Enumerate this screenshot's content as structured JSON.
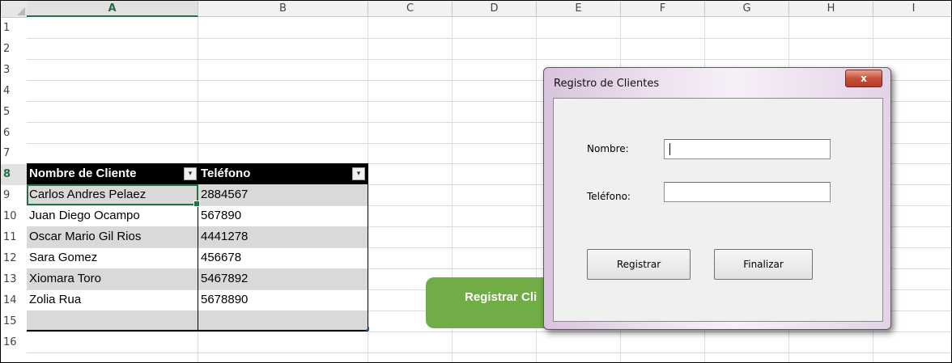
{
  "columns": [
    "A",
    "B",
    "C",
    "D",
    "E",
    "F",
    "G",
    "H",
    "I"
  ],
  "rows": [
    "1",
    "2",
    "3",
    "4",
    "5",
    "6",
    "7",
    "8",
    "9",
    "10",
    "11",
    "12",
    "13",
    "14",
    "15",
    "16"
  ],
  "table": {
    "headers": [
      "Nombre de Cliente",
      "Teléfono"
    ],
    "filter_icons": [
      "sort-filter-icon",
      "filter-dropdown-icon"
    ],
    "data": [
      [
        "Carlos Andres Pelaez",
        "2884567"
      ],
      [
        "Juan Diego Ocampo",
        "567890"
      ],
      [
        "Oscar Mario Gil Rios",
        "4441278"
      ],
      [
        "Sara Gomez",
        "456678"
      ],
      [
        "Xiomara Toro",
        "5467892"
      ],
      [
        "Zolia Rua",
        "5678890"
      ],
      [
        "",
        ""
      ]
    ]
  },
  "shape_button": {
    "label": "Registrar Cli",
    "color": "#70ad47"
  },
  "dialog": {
    "title": "Registro de Clientes",
    "close_label": "x",
    "name_label": "Nombre:",
    "name_value": "",
    "phone_label": "Teléfono:",
    "phone_value": "",
    "register_button": "Registrar",
    "finish_button": "Finalizar"
  },
  "colors": {
    "accent": "#217346",
    "header_bg": "#000000",
    "band": "#d9d9d9"
  }
}
